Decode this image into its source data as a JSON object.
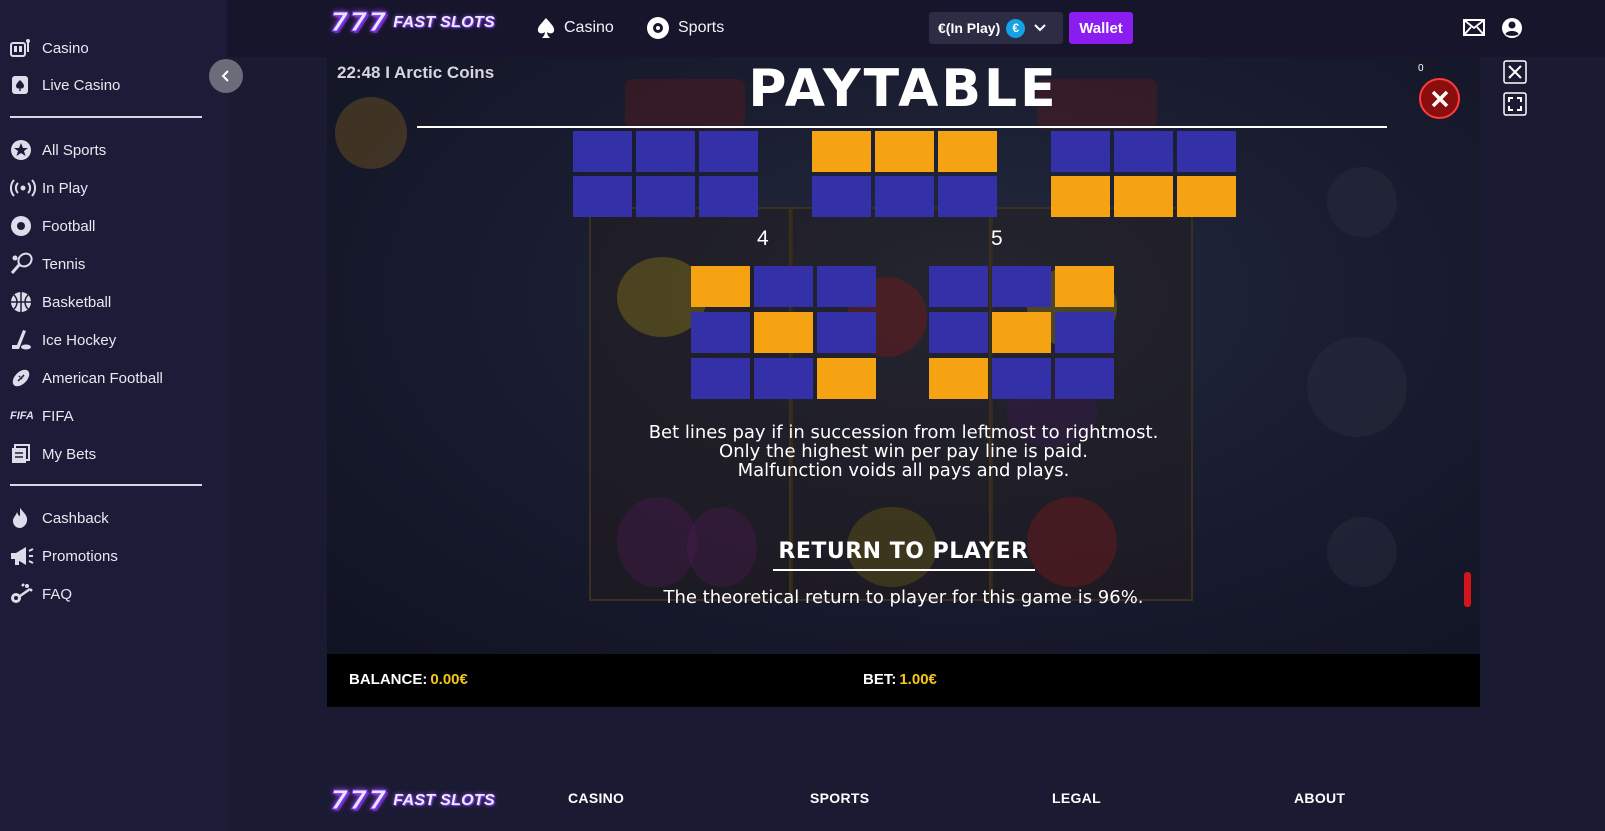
{
  "sidebar": {
    "items": [
      {
        "label": "Casino",
        "icon": "casino-icon"
      },
      {
        "label": "Live Casino",
        "icon": "spade-icon"
      },
      {
        "label": "All Sports",
        "icon": "star-icon"
      },
      {
        "label": "In Play",
        "icon": "broadcast-icon"
      },
      {
        "label": "Football",
        "icon": "football-icon"
      },
      {
        "label": "Tennis",
        "icon": "tennis-icon"
      },
      {
        "label": "Basketball",
        "icon": "basketball-icon"
      },
      {
        "label": "Ice Hockey",
        "icon": "hockey-icon"
      },
      {
        "label": "American Football",
        "icon": "american-football-icon"
      },
      {
        "label": "FIFA",
        "icon": "fifa-icon"
      },
      {
        "label": "My Bets",
        "icon": "bets-icon"
      },
      {
        "label": "Cashback",
        "icon": "flame-icon"
      },
      {
        "label": "Promotions",
        "icon": "megaphone-icon"
      },
      {
        "label": "FAQ",
        "icon": "faq-icon"
      }
    ]
  },
  "header": {
    "logo_num": "777",
    "logo_text": "FAST SLOTS",
    "nav": [
      {
        "label": "Casino",
        "icon": "spade-icon"
      },
      {
        "label": "Sports",
        "icon": "ball-icon"
      }
    ],
    "balance_label": "€(In Play)",
    "currency_symbol": "€",
    "wallet_label": "Wallet"
  },
  "game": {
    "title": "22:48 I Arctic Coins",
    "paytable_title": "PAYTABLE",
    "line_numbers": [
      "4",
      "5"
    ],
    "rules": [
      "Bet lines pay if in succession from leftmost to rightmost.",
      "Only the highest win per pay line is paid.",
      "Malfunction voids all pays and plays."
    ],
    "rtp_heading": "RETURN TO PLAYER",
    "rtp_text": "The theoretical return to player for this game is 96%.",
    "counter": "0",
    "balance_label": "BALANCE:",
    "balance_value": "0.00€",
    "bet_label": "BET:",
    "bet_value": "1.00€",
    "colors": {
      "highlight": "#f6a313",
      "base": "#3431a8"
    }
  },
  "footer": {
    "logo_num": "777",
    "logo_text": "FAST SLOTS",
    "columns": [
      "CASINO",
      "SPORTS",
      "LEGAL",
      "ABOUT"
    ]
  }
}
